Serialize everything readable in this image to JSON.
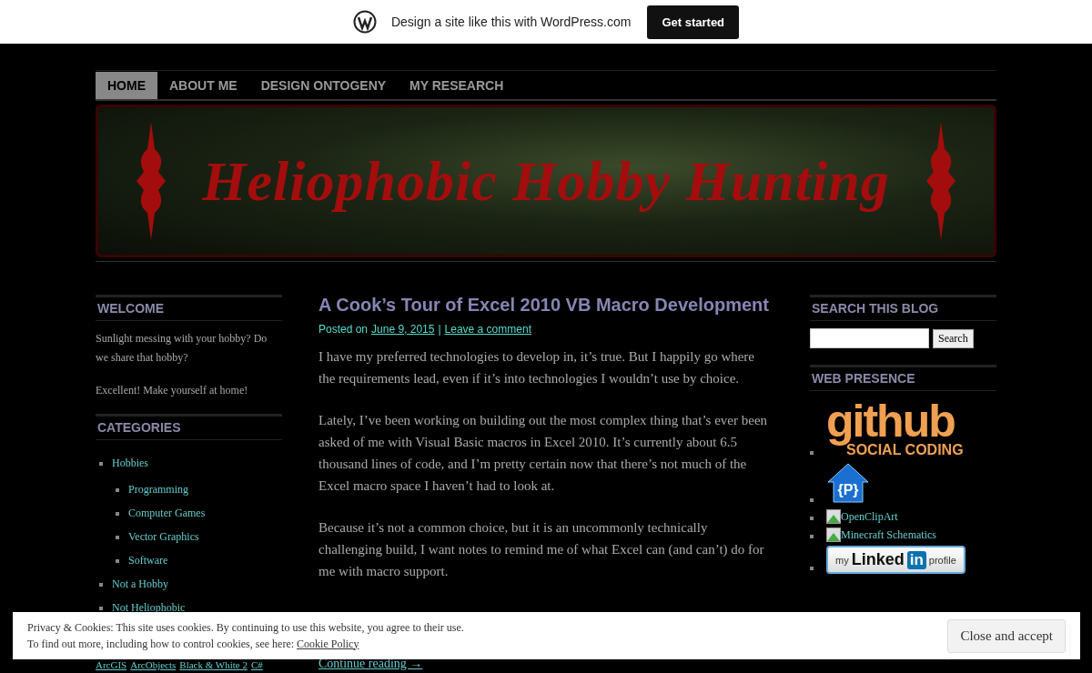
{
  "wp_bar": {
    "text": "Design a site like this with WordPress.com",
    "button": "Get started"
  },
  "nav": [
    {
      "label": "HOME",
      "selected": true
    },
    {
      "label": "ABOUT ME",
      "selected": false
    },
    {
      "label": "DESIGN ONTOGENY",
      "selected": false
    },
    {
      "label": "MY RESEARCH",
      "selected": false
    }
  ],
  "header": {
    "title": "Heliophobic Hobby Hunting"
  },
  "sidebar_left": {
    "welcome": {
      "title": "WELCOME",
      "paragraphs": [
        "Sunlight messing with your hobby? Do we share that hobby?",
        "Excellent! Make yourself at home!"
      ]
    },
    "categories": {
      "title": "CATEGORIES",
      "items": [
        {
          "label": "Hobbies",
          "children": [
            {
              "label": "Programming"
            },
            {
              "label": "Computer Games"
            },
            {
              "label": "Vector Graphics"
            },
            {
              "label": "Software"
            }
          ]
        },
        {
          "label": "Not a Hobby"
        },
        {
          "label": "Not Heliophobic"
        }
      ]
    },
    "tags": [
      "ArcGIS",
      "ArcObjects",
      "Black & White 2",
      "C#"
    ]
  },
  "post": {
    "title": "A Cook’s Tour of Excel 2010 VB Macro Development",
    "meta": {
      "prefix": "Posted on",
      "date": "June 9, 2015",
      "separator": "|",
      "comment_link": "Leave a comment"
    },
    "paragraphs": [
      "I have my preferred technologies to develop in, it’s true. But I happily go where the requirements lead, even if it’s into technologies I wouldn’t use by choice.",
      "Lately, I’ve been working on building out the most complex thing that’s ever been asked of me with Visual Basic macros in Excel 2010. It’s currently about 6.5 thousand lines of code, and I’m pretty certain now that there’s not much of the Excel macro space I haven’t had to look at.",
      "Because it’s not a common choice, but it is an uncommonly technically challenging build, I want notes to remind me of what Excel can (and can’t) do for me with macro support."
    ],
    "continue": "Continue reading →"
  },
  "sidebar_right": {
    "search": {
      "title": "SEARCH THIS BLOG",
      "button": "Search"
    },
    "web_presence": {
      "title": "WEB PRESENCE",
      "items": [
        {
          "kind": "github",
          "logo": "github",
          "tagline": "SOCIAL CODING"
        },
        {
          "kind": "house",
          "logo": "{P}"
        },
        {
          "kind": "broken",
          "alt": "OpenClipArt"
        },
        {
          "kind": "broken",
          "alt": "Minecraft Schematics"
        },
        {
          "kind": "linkedin",
          "prefix": "my",
          "brand": "Linked",
          "badge": "in",
          "suffix": "profile"
        }
      ]
    }
  },
  "cookie_banner": {
    "line1": "Privacy & Cookies: This site uses cookies. By continuing to use this website, you agree to their use.",
    "line2": "To find out more, including how to control cookies, see here:",
    "link": "Cookie Policy",
    "button": "Close and accept"
  }
}
